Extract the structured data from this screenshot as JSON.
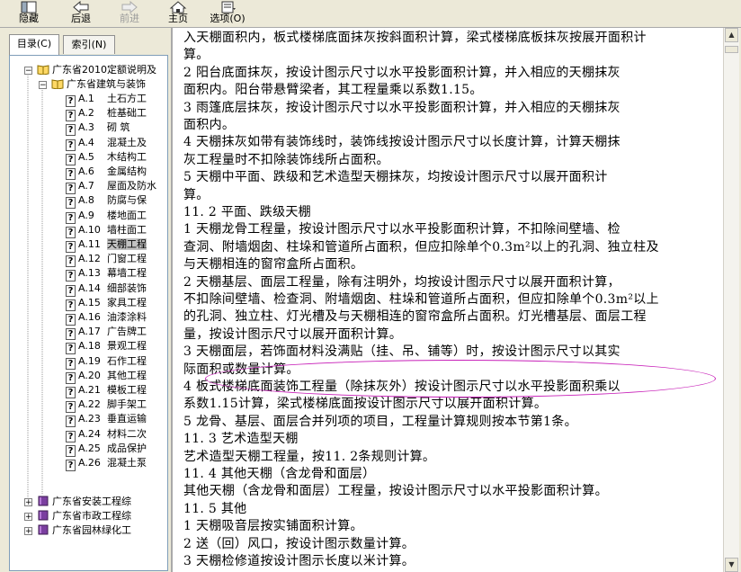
{
  "toolbar": {
    "hide": "隐藏",
    "back": "后退",
    "forward": "前进",
    "home": "主页",
    "options": "选项(O)"
  },
  "tabs": {
    "contents": "目录(C)",
    "index": "索引(N)"
  },
  "tree": {
    "root": "广东省2010定额说明及",
    "building": "广东省建筑与装饰",
    "items": [
      {
        "code": "A.1",
        "label": "土石方工"
      },
      {
        "code": "A.2",
        "label": "桩基础工"
      },
      {
        "code": "A.3",
        "label": "砌  筑"
      },
      {
        "code": "A.4",
        "label": "混凝土及"
      },
      {
        "code": "A.5",
        "label": "木结构工"
      },
      {
        "code": "A.6",
        "label": "金属结构"
      },
      {
        "code": "A.7",
        "label": "屋面及防水"
      },
      {
        "code": "A.8",
        "label": "防腐与保"
      },
      {
        "code": "A.9",
        "label": "楼地面工"
      },
      {
        "code": "A.10",
        "label": "墙柱面工"
      },
      {
        "code": "A.11",
        "label": "天棚工程"
      },
      {
        "code": "A.12",
        "label": "门窗工程"
      },
      {
        "code": "A.13",
        "label": "幕墙工程"
      },
      {
        "code": "A.14",
        "label": "细部装饰"
      },
      {
        "code": "A.15",
        "label": "家具工程"
      },
      {
        "code": "A.16",
        "label": "油漆涂料"
      },
      {
        "code": "A.17",
        "label": "广告牌工"
      },
      {
        "code": "A.18",
        "label": "景观工程"
      },
      {
        "code": "A.19",
        "label": "石作工程"
      },
      {
        "code": "A.20",
        "label": "其他工程"
      },
      {
        "code": "A.21",
        "label": "模板工程"
      },
      {
        "code": "A.22",
        "label": "脚手架工"
      },
      {
        "code": "A.23",
        "label": "垂直运输"
      },
      {
        "code": "A.24",
        "label": "材料二次"
      },
      {
        "code": "A.25",
        "label": "成品保护"
      },
      {
        "code": "A.26",
        "label": "混凝土泵"
      }
    ],
    "collapsed": [
      "广东省安装工程综",
      "广东省市政工程综",
      "广东省园林绿化工"
    ]
  },
  "content": {
    "lines": [
      "入天棚面积内，板式楼梯底面抹灰按斜面积计算，梁式楼梯底板抹灰按展开面积计",
      "算。",
      "    2  阳台底面抹灰，按设计图示尺寸以水平投影面积计算，并入相应的天棚抹灰",
      "面积内。阳台带悬臂梁者，其工程量乘以系数1.15。",
      "    3  雨篷底层抹灰，按设计图示尺寸以水平投影面积计算，并入相应的天棚抹灰",
      "面积内。",
      "    4  天棚抹灰如带有装饰线时，装饰线按设计图示尺寸以长度计算，计算天棚抹",
      "灰工程量时不扣除装饰线所占面积。",
      "    5  天棚中平面、跌级和艺术造型天棚抹灰，均按设计图示尺寸以展开面积计",
      "算。",
      "11. 2  平面、跌级天棚",
      "    1  天棚龙骨工程量，按设计图示尺寸以水平投影面积计算，不扣除间壁墙、检",
      "查洞、附墙烟囱、柱垛和管道所占面积，但应扣除单个0.3m²以上的孔洞、独立柱及",
      "与天棚相连的窗帘盒所占面积。",
      "    2  天棚基层、面层工程量，除有注明外，均按设计图示尺寸以展开面积计算，",
      "不扣除间壁墙、检查洞、附墙烟囱、柱垛和管道所占面积，但应扣除单个0.3m²以上",
      "的孔洞、独立柱、灯光槽及与天棚相连的窗帘盒所占面积。灯光槽基层、面层工程",
      "量，按设计图示尺寸以展开面积计算。",
      "    3  天棚面层，若饰面材料没满贴（挂、吊、铺等）时，按设计图示尺寸以其实",
      "际面积或数量计算。",
      "    4  板式楼梯底面装饰工程量（除抹灰外）按设计图示尺寸以水平投影面积乘以",
      "系数1.15计算，梁式楼梯底面按设计图示尺寸以展开面积计算。",
      "    5  龙骨、基层、面层合并列项的项目，工程量计算规则按本节第1条。",
      "11. 3  艺术造型天棚",
      "    艺术造型天棚工程量，按11. 2条规则计算。",
      "11. 4  其他天棚（含龙骨和面层）",
      "    其他天棚（含龙骨和面层）工程量，按设计图示尺寸以水平投影面积计算。",
      "11. 5  其他",
      "    1  天棚吸音层按实铺面积计算。",
      "    2  送（回）风口，按设计图示数量计算。",
      "    3  天棚检修道按设计图示长度以米计算。"
    ]
  },
  "colors": {
    "highlight_ellipse": "#c71fb8"
  }
}
